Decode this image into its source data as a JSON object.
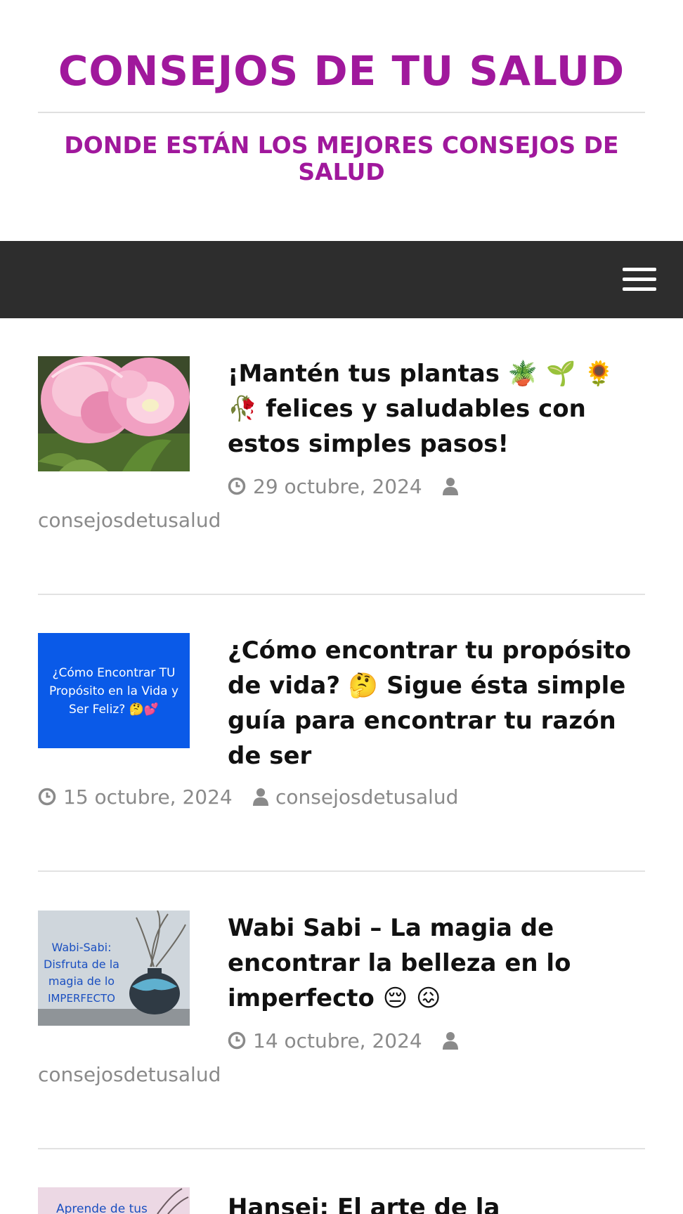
{
  "site": {
    "title": "CONSEJOS DE TU SALUD",
    "tagline": "DONDE ESTÁN LOS MEJORES CONSEJOS DE SALUD"
  },
  "nav": {
    "menu_icon": "hamburger-menu-icon"
  },
  "posts": [
    {
      "title": "¡Mantén tus plantas 🪴 🌱 🌻 🥀 felices y saludables con estos simples pasos!",
      "date": "29 octubre, 2024",
      "author": "consejosdetusalud",
      "thumbnail": "pink-tulips-photo"
    },
    {
      "title": "¿Cómo encontrar tu propósito de vida? 🤔 Sigue ésta simple guía para encontrar tu razón de ser",
      "date": "15 octubre, 2024",
      "author": "consejosdetusalud",
      "thumbnail_text": "¿Cómo Encontrar TU Propósito en la Vida y Ser Feliz? 🤔💕"
    },
    {
      "title": "Wabi Sabi – La magia de encontrar la belleza en lo imperfecto 😔 😖",
      "date": "14 octubre, 2024",
      "author": "consejosdetusalud",
      "thumbnail_text": "Wabi-Sabi: Disfruta de la magia de lo IMPERFECTO"
    },
    {
      "title": "Hansei: El arte de la",
      "thumbnail_text": "Aprende de tus"
    }
  ],
  "colors": {
    "brand": "#a0189c",
    "navbar": "#2d2d2d",
    "meta": "#8a8a8a"
  }
}
